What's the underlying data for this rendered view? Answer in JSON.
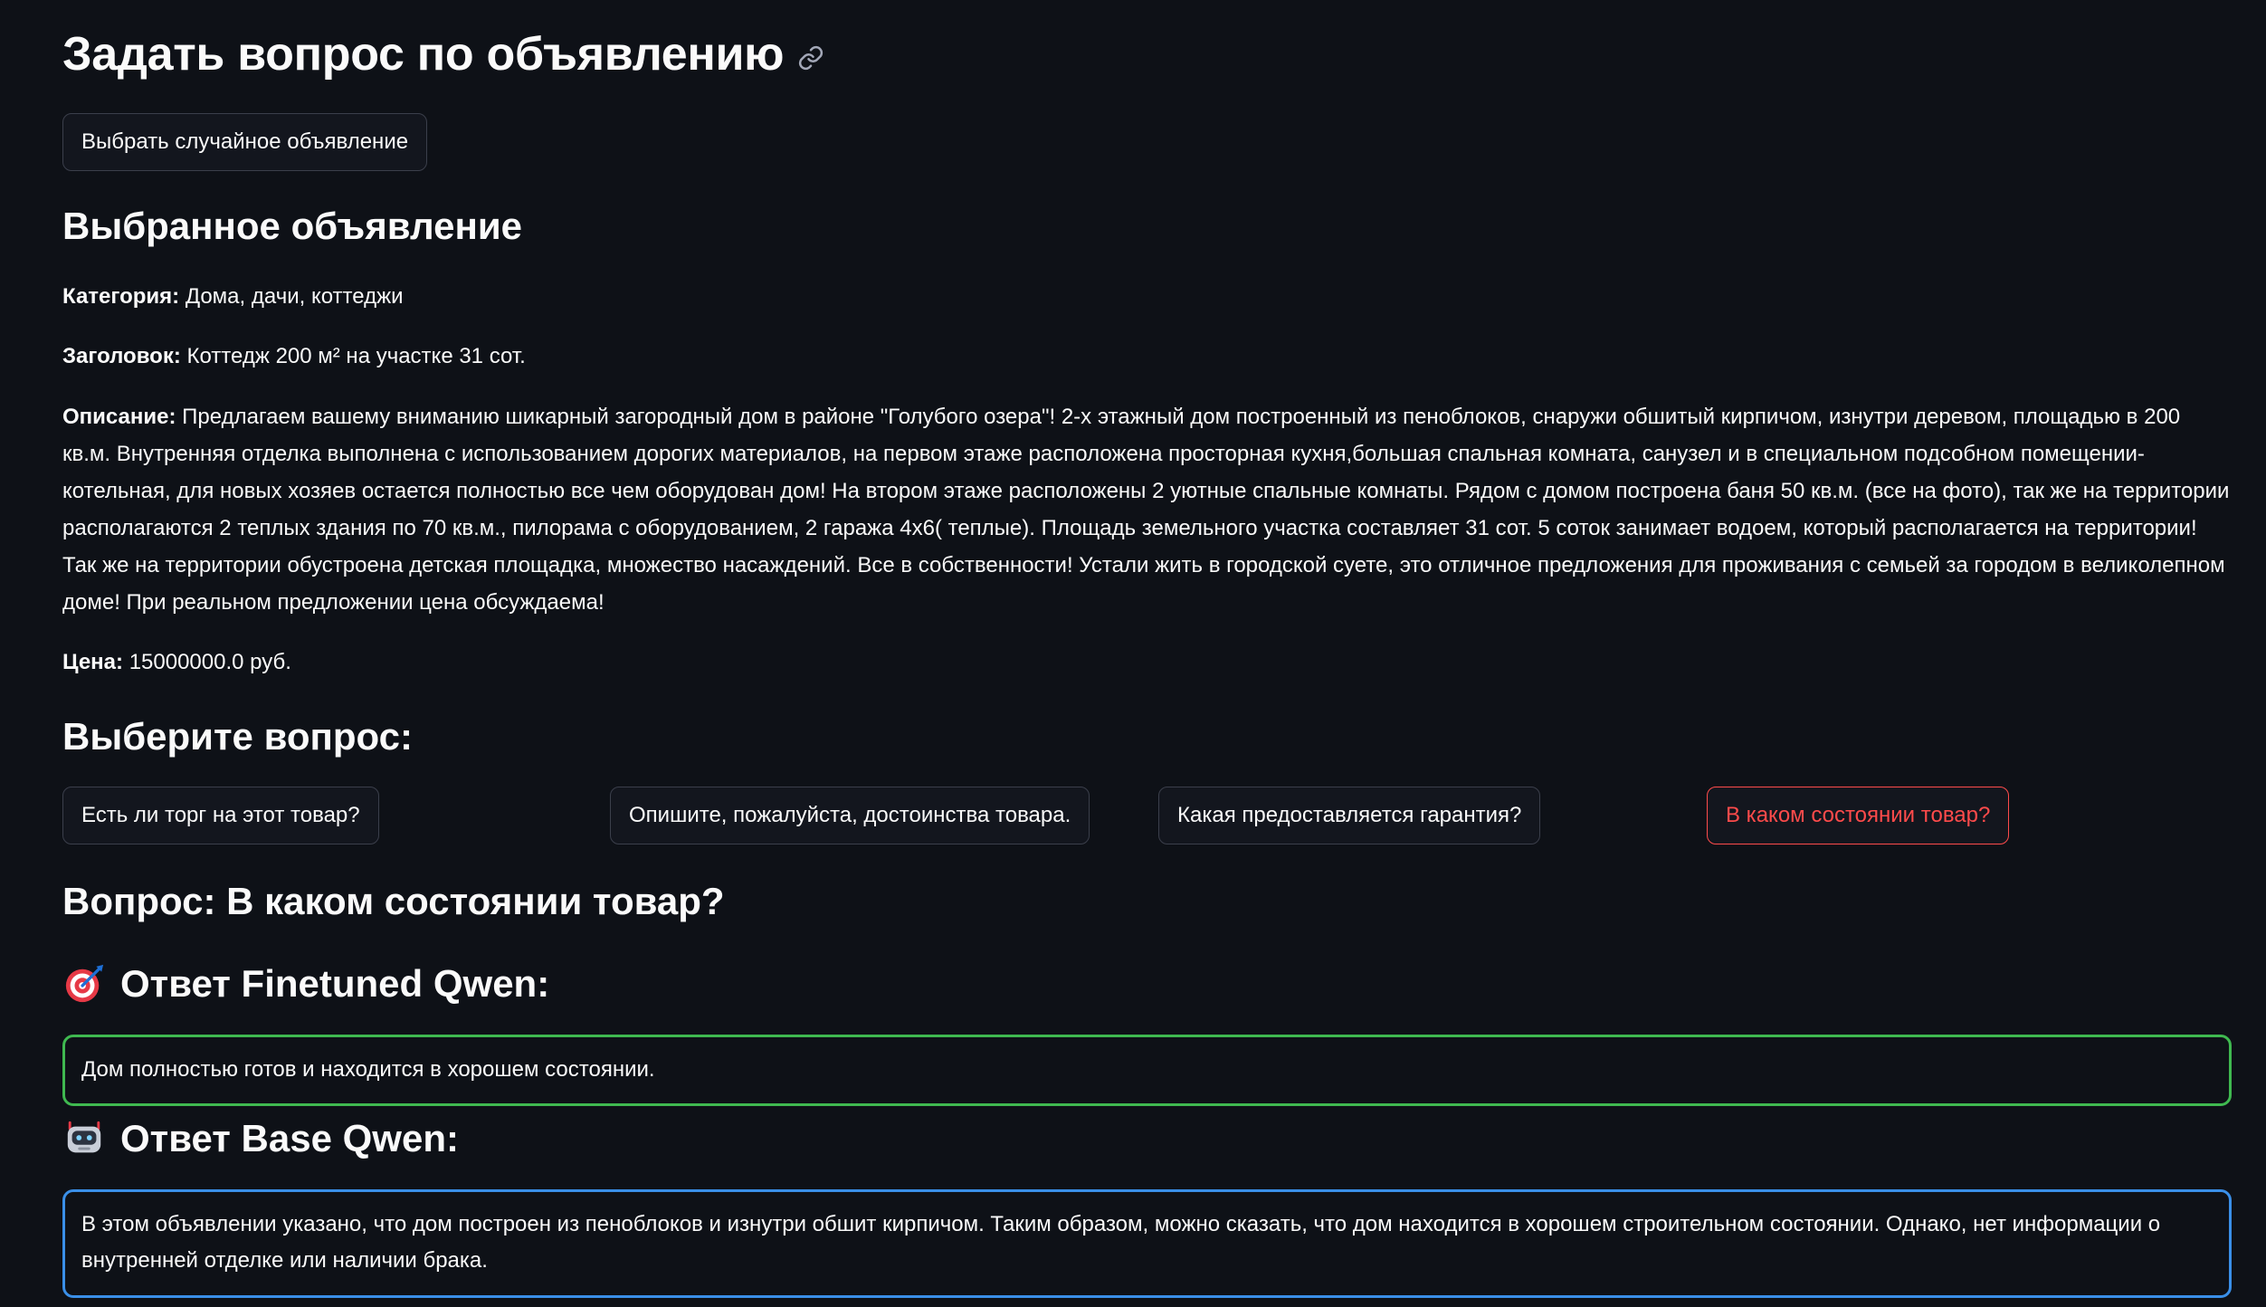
{
  "page": {
    "title": "Задать вопрос по объявлению",
    "random_button": "Выбрать случайное объявление"
  },
  "listing": {
    "section_title": "Выбранное объявление",
    "category_label": "Категория:",
    "category_value": "Дома, дачи, коттеджи",
    "heading_label": "Заголовок:",
    "heading_value": "Коттедж 200 м² на участке 31 сот.",
    "description_label": "Описание:",
    "description_value": "Предлагаем вашему вниманию шикарный загородный дом в районе \"Голубого озера\"! 2-х этажный дом построенный из пеноблоков, снаружи обшитый кирпичом, изнутри деревом, площадью в 200 кв.м. Внутренняя отделка выполнена с использованием дорогих материалов, на первом этаже расположена просторная кухня,большая спальная комната, санузел и в специальном подсобном помещении- котельная, для новых хозяев остается полностью все чем оборудован дом! На втором этаже расположены 2 уютные спальные комнаты. Рядом с домом построена баня 50 кв.м. (все на фото), так же на территории располагаются 2 теплых здания по 70 кв.м., пилорама с оборудованием, 2 гаража 4х6( теплые). Площадь земельного участка составляет 31 сот. 5 соток занимает водоем, который располагается на территории! Так же на территории обустроена детская площадка, множество насаждений. Все в собственности! Устали жить в городской суете, это отличное предложения для проживания с семьей за городом в великолепном доме! При реальном предложении цена обсуждаема!",
    "price_label": "Цена:",
    "price_value": "15000000.0 руб."
  },
  "questions": {
    "section_title": "Выберите вопрос:",
    "options": [
      "Есть ли торг на этот товар?",
      "Опишите, пожалуйста, достоинства товара.",
      "Какая предоставляется гарантия?",
      "В каком состоянии товар?"
    ],
    "selected_index": 3
  },
  "result": {
    "question_heading": "Вопрос: В каком состоянии товар?",
    "finetuned_heading": "Ответ Finetuned Qwen:",
    "finetuned_answer": "Дом полностью готов и находится в хорошем состоянии.",
    "base_heading": "Ответ Base Qwen:",
    "base_answer": "В этом объявлении указано, что дом построен из пеноблоков и изнутри обшит кирпичом. Таким образом, можно сказать, что дом находится в хорошем строительном состоянии. Однако, нет информации о внутренней отделке или наличии брака."
  },
  "icons": {
    "title_anchor": "link-icon",
    "finetuned": "target-icon",
    "base": "robot-icon"
  },
  "colors": {
    "background": "#0e1117",
    "selected_accent": "#ff4b4b",
    "finetuned_border": "#3fb950",
    "base_border": "#3a8fe8"
  }
}
